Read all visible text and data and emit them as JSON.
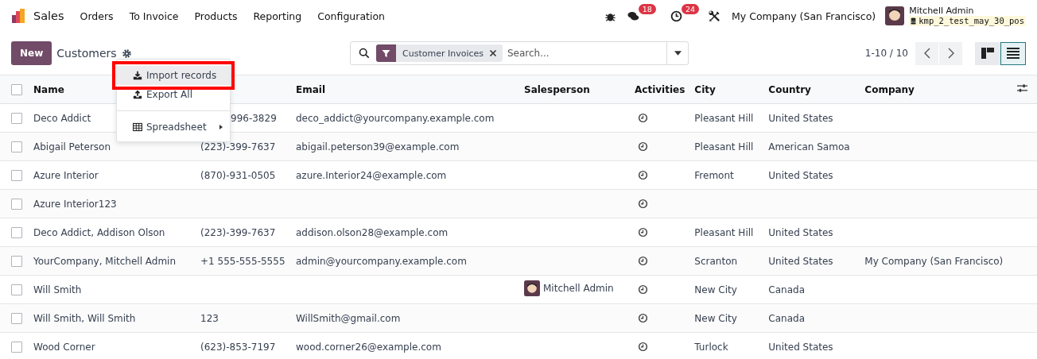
{
  "navbar": {
    "app": "Sales",
    "menu": [
      "Orders",
      "To Invoice",
      "Products",
      "Reporting",
      "Configuration"
    ],
    "messages_badge": "18",
    "activities_badge": "24",
    "company": "My Company (San Francisco)",
    "user": "Mitchell Admin",
    "database": "kmp_2_test_may_30_pos"
  },
  "control": {
    "new_button": "New",
    "title": "Customers",
    "facet": "Customer Invoices",
    "search_placeholder": "Search...",
    "pager": "1-10 / 10",
    "views": [
      {
        "kind": "kanban",
        "selected": false
      },
      {
        "kind": "list",
        "selected": true
      }
    ]
  },
  "menu": [
    {
      "kind": "import",
      "label": "Import records",
      "highlighted": true
    },
    {
      "kind": "export",
      "label": "Export All",
      "highlighted": false
    },
    {
      "kind": "divider"
    },
    {
      "kind": "spreadsheet",
      "label": "Spreadsheet",
      "highlighted": false
    }
  ],
  "table": {
    "select_all_checked": false,
    "columns": [
      "Name",
      null,
      "Email",
      "Salesperson",
      "Activities",
      "City",
      "Country",
      "Company"
    ],
    "rows": [
      {
        "checked": false,
        "name": "Deco Addict",
        "phone": "996-3829",
        "phone_covered": true,
        "email": "deco_addict@yourcompany.example.com",
        "city": "Pleasant Hill",
        "country": "United States"
      },
      {
        "checked": false,
        "name": "Abigail Peterson",
        "phone": "(223)-399-7637",
        "email": "abigail.peterson39@example.com",
        "city": "Pleasant Hill",
        "country": "American Samoa"
      },
      {
        "checked": false,
        "name": "Azure Interior",
        "phone": "(870)-931-0505",
        "email": "azure.Interior24@example.com",
        "city": "Fremont",
        "country": "United States"
      },
      {
        "checked": false,
        "name": "Azure Interior123"
      },
      {
        "checked": false,
        "name": "Deco Addict, Addison Olson",
        "phone": "(223)-399-7637",
        "email": "addison.olson28@example.com",
        "city": "Pleasant Hill",
        "country": "United States"
      },
      {
        "checked": false,
        "name": "YourCompany, Mitchell Admin",
        "phone": "+1 555-555-5555",
        "email": "admin@yourcompany.example.com",
        "city": "Scranton",
        "country": "United States",
        "company": "My Company (San Francisco)"
      },
      {
        "checked": false,
        "name": "Will Smith",
        "salesperson": "Mitchell Admin",
        "city": "New City",
        "country": "Canada"
      },
      {
        "checked": false,
        "name": "Will Smith, Will Smith",
        "phone": "123",
        "email": "WillSmith@gmail.com",
        "city": "New City",
        "country": "Canada"
      },
      {
        "checked": false,
        "name": "Wood Corner",
        "phone": "(623)-853-7197",
        "email": "wood.corner26@example.com",
        "city": "Turlock",
        "country": "United States"
      }
    ]
  }
}
